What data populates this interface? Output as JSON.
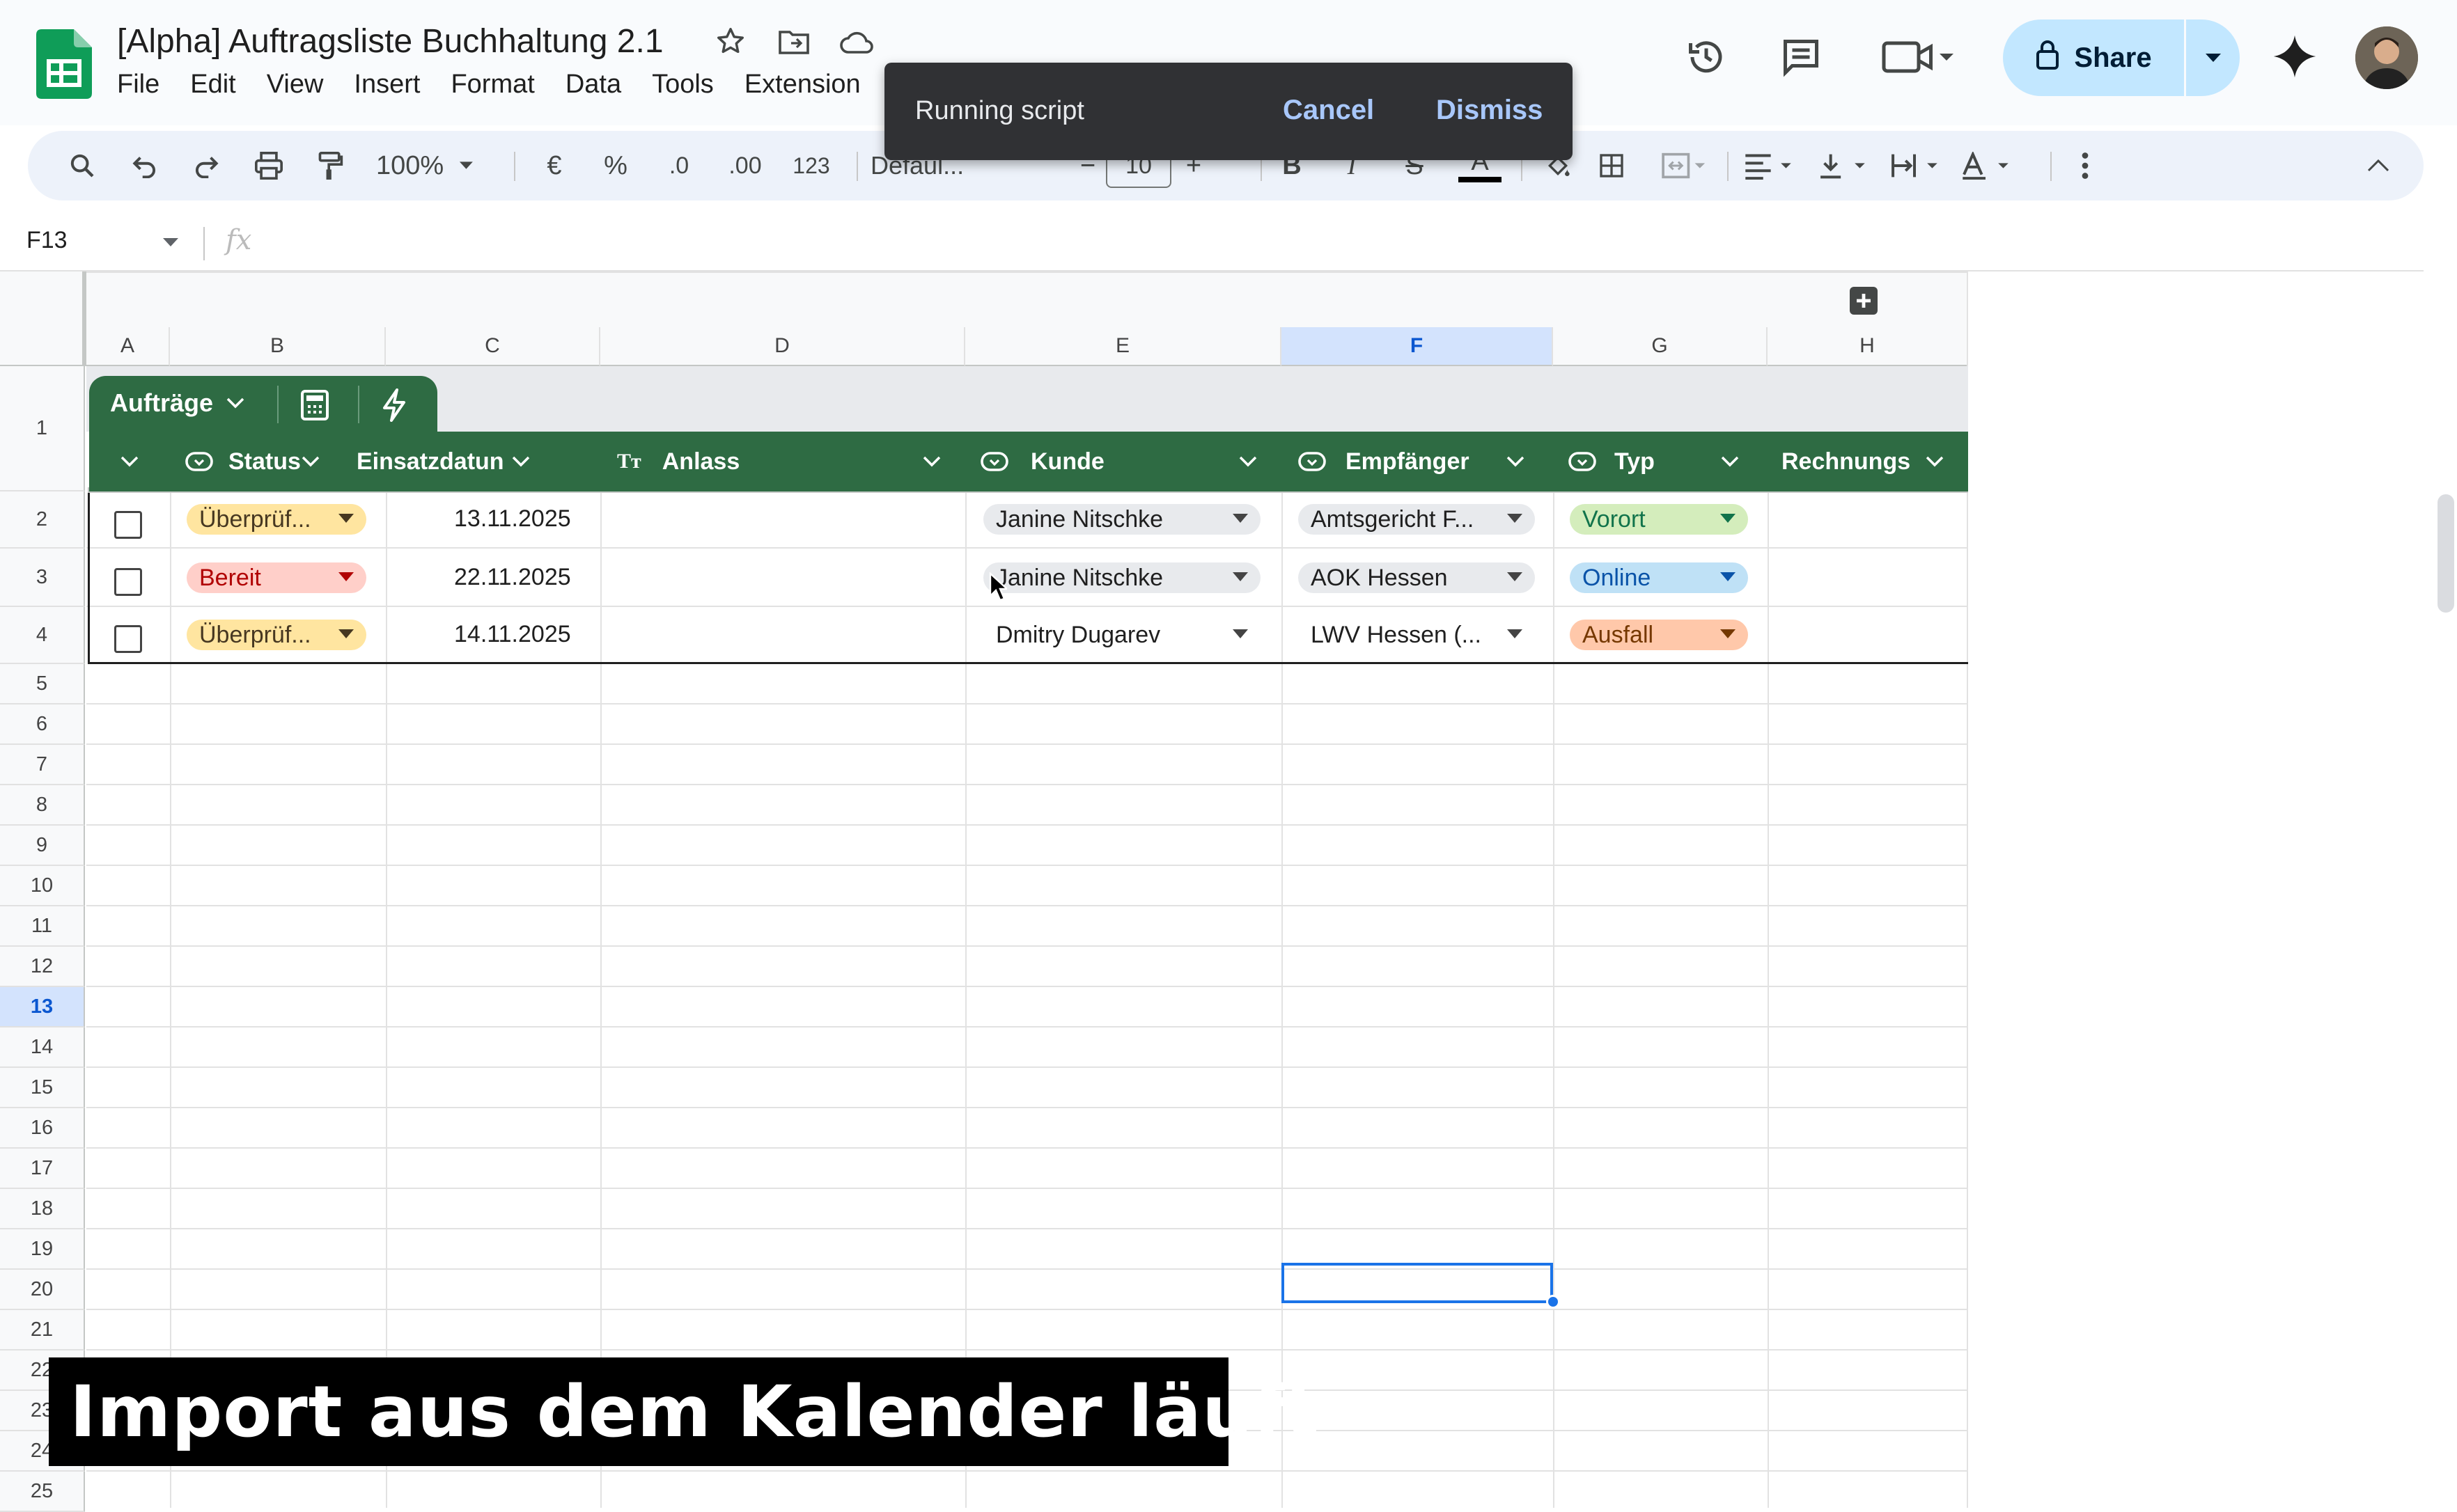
{
  "app": {
    "doc_title": "[Alpha] Auftragsliste Buchhaltung 2.1",
    "menu": [
      "File",
      "Edit",
      "View",
      "Insert",
      "Format",
      "Data",
      "Tools",
      "Extension"
    ],
    "share_label": "Share"
  },
  "toolbar": {
    "zoom": "100%",
    "currency": "€",
    "percent": "%",
    "dec_decrease": ".0",
    "dec_increase": ".00",
    "number_format": "123",
    "font": "Defaul...",
    "font_size": "10",
    "bold": "B",
    "italic": "I",
    "strike": "S",
    "text_color": "A"
  },
  "toast": {
    "message": "Running script",
    "cancel": "Cancel",
    "dismiss": "Dismiss"
  },
  "formula_bar": {
    "name_box": "F13",
    "fx": "fx"
  },
  "columns": [
    "A",
    "B",
    "C",
    "D",
    "E",
    "F",
    "G",
    "H"
  ],
  "rows": [
    "1",
    "2",
    "3",
    "4",
    "5",
    "6",
    "7",
    "8",
    "9",
    "10",
    "11",
    "12",
    "13",
    "14",
    "15",
    "16",
    "17",
    "18",
    "19",
    "20",
    "21",
    "22",
    "23",
    "24",
    "25"
  ],
  "table": {
    "name": "Aufträge",
    "headers": {
      "status": "Status",
      "einsatzdatum": "Einsatzdatun",
      "anlass": "Anlass",
      "kunde": "Kunde",
      "empfaenger": "Empfänger",
      "typ": "Typ",
      "rechnung": "Rechnungs"
    },
    "rows": [
      {
        "status": "Überprüf...",
        "status_color": "#ffe5a0",
        "date": "13.11.2025",
        "kunde": "Janine Nitschke",
        "empfaenger": "Amtsgericht F...",
        "typ": "Vorort",
        "typ_color": "#d4edbc"
      },
      {
        "status": "Bereit",
        "status_color": "#ffcfc9",
        "date": "22.11.2025",
        "kunde": "Janine Nitschke",
        "empfaenger": "AOK Hessen",
        "typ": "Online",
        "typ_color": "#bfe1f6"
      },
      {
        "status": "Überprüf...",
        "status_color": "#ffe5a0",
        "date": "14.11.2025",
        "kunde": "Dmitry Dugarev",
        "empfaenger": "LWV Hessen (...",
        "typ": "Ausfall",
        "typ_color": "#ffc8aa"
      }
    ]
  },
  "caption": "Import aus dem Kalender läuft",
  "colors": {
    "table_header": "#2e6b43",
    "share_bg": "#c2e7ff",
    "selection": "#1a73e8"
  }
}
